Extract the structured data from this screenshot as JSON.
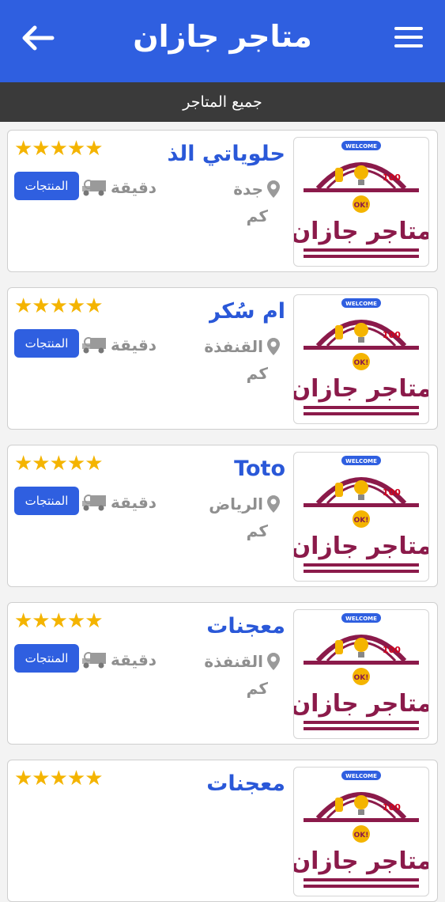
{
  "header": {
    "title": "متاجر جازان",
    "back_icon": "arrow-left-icon",
    "menu_icon": "hamburger-menu-icon",
    "background": "#2f5fe0"
  },
  "subheader": {
    "label": "جميع المتاجر"
  },
  "stores": [
    {
      "name": "حلوياتي الذ",
      "city": "جدة",
      "distance_unit": "كم",
      "time_unit": "دقيقة",
      "products_label": "المنتجات",
      "rating": 5,
      "rating_stars": "★★★★★"
    },
    {
      "name": "ام سُكر",
      "city": "القنفذة",
      "distance_unit": "كم",
      "time_unit": "دقيقة",
      "products_label": "المنتجات",
      "rating": 5,
      "rating_stars": "★★★★★"
    },
    {
      "name": "Toto",
      "city": "الرياض",
      "distance_unit": "كم",
      "time_unit": "دقيقة",
      "products_label": "المنتجات",
      "rating": 5,
      "rating_stars": "★★★★★"
    },
    {
      "name": "معجنات",
      "city": "القنفذة",
      "distance_unit": "كم",
      "time_unit": "دقيقة",
      "products_label": "المنتجات",
      "rating": 5,
      "rating_stars": "★★★★★"
    },
    {
      "name": "معجنات",
      "city": "",
      "distance_unit": "",
      "time_unit": "",
      "products_label": "",
      "rating": 5,
      "rating_stars": "★★★★★"
    }
  ],
  "logo": {
    "welcome_text": "WELCOME",
    "brand_text": "متاجر جازان",
    "ok_text": "OK!",
    "badge_text": "100"
  },
  "colors": {
    "primary": "#2f5fe0",
    "star": "#f4b400",
    "logo_maroon": "#8b1a4a"
  }
}
